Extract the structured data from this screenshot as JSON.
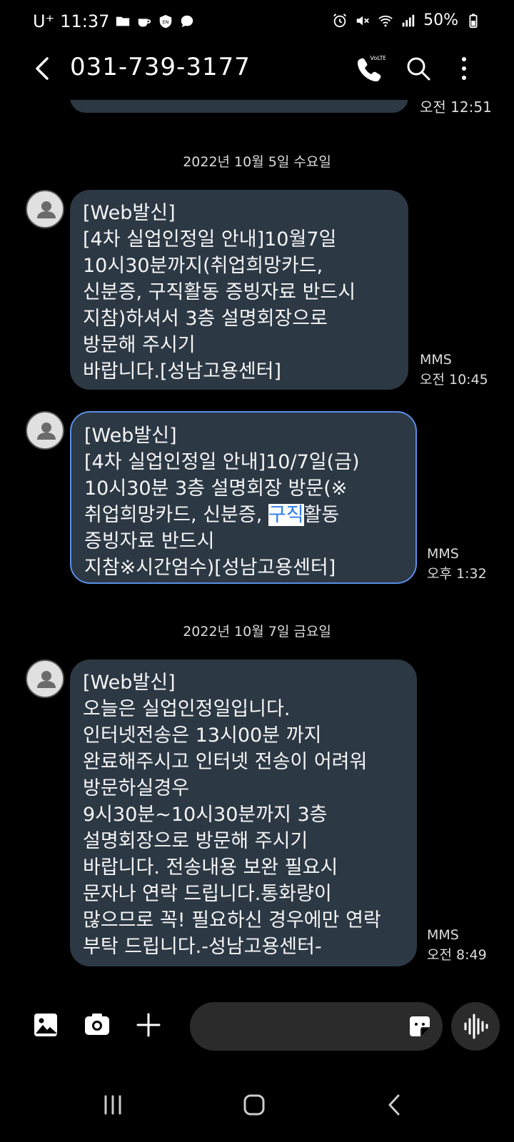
{
  "status": {
    "carrier": "U⁺",
    "time": "11:37",
    "battery": "50%",
    "icons": [
      "folder-icon",
      "coffee-icon",
      "en-shield-icon",
      "chat-icon",
      "alarm-icon",
      "mute-icon",
      "wifi-icon",
      "signal-icon",
      "battery-icon"
    ]
  },
  "header": {
    "title": "031-739-3177",
    "icons": [
      "back-arrow-icon",
      "volte-call-icon",
      "search-icon",
      "more-vert-icon"
    ],
    "volte_label": "VoLTE"
  },
  "previous": {
    "time": "오전 12:51"
  },
  "dates": [
    "2022년 10월 5일 수요일",
    "2022년 10월 7일 금요일"
  ],
  "messages": [
    {
      "lines": [
        "[Web발신]",
        "[4차 실업인정일 안내]10월7일",
        "10시30분까지(취업희망카드,",
        "신분증, 구직활동 증빙자료 반드시",
        "지참)하셔서 3층 설명회장으로",
        "방문해 주시기",
        "바랍니다.[성남고용센터]"
      ],
      "type": "MMS",
      "time": "오전 10:45"
    },
    {
      "lines": [
        "[Web발신]",
        "[4차 실업인정일 안내]10/7일(금)",
        "10시30분 3층 설명회장 방문(※",
        "취업희망카드, 신분증, 구직활동",
        "증빙자료 반드시",
        "지참※시간엄수)[성남고용센터]"
      ],
      "highlight": "구직",
      "type": "MMS",
      "time": "오후 1:32"
    },
    {
      "lines": [
        "[Web발신]",
        "오늘은 실업인정일입니다.",
        "인터넷전송은 13시00분 까지",
        "완료해주시고 인터넷 전송이 어려워",
        "방문하실경우",
        "9시30분~10시30분까지 3층",
        "설명회장으로 방문해 주시기",
        "바랍니다. 전송내용 보완 필요시",
        "문자나 연락 드립니다.통화량이",
        "많으므로 꼭! 필요하신 경우에만 연락",
        "부탁 드립니다.-성남고용센터-"
      ],
      "type": "MMS",
      "time": "오전 8:49"
    }
  ],
  "composer": {
    "placeholder": "",
    "icons": [
      "gallery-icon",
      "camera-icon",
      "plus-icon",
      "sticker-icon",
      "voice-icon"
    ]
  },
  "nav": {
    "icons": [
      "recents-icon",
      "home-icon",
      "back-icon"
    ]
  },
  "colors": {
    "bubble": "#2c3844",
    "selection": "#5b8fe6",
    "highlight_text": "#2f7ee8"
  }
}
